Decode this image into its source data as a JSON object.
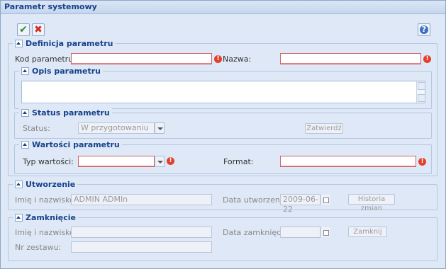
{
  "window": {
    "title": "Parametr systemowy"
  },
  "toolbar": {
    "ok_icon": "check-icon",
    "cancel_icon": "x-icon",
    "help_icon": "question-icon"
  },
  "definicja": {
    "legend": "Definicja parametru",
    "kod_label": "Kod parametru:",
    "kod_value": "",
    "nazwa_label": "Nazwa:",
    "nazwa_value": "",
    "opis": {
      "legend": "Opis parametru",
      "value": ""
    },
    "status": {
      "legend": "Status parametru",
      "label": "Status:",
      "value": "W przygotowaniu",
      "button": "Zatwierdź"
    },
    "wartosci": {
      "legend": "Wartości parametru",
      "typ_label": "Typ wartości:",
      "typ_value": "",
      "format_label": "Format:",
      "format_value": ""
    }
  },
  "utworzenie": {
    "legend": "Utworzenie",
    "imie_label": "Imię i nazwisko:",
    "imie_value": "ADMIN ADMIn",
    "data_label": "Data utworzenia:",
    "data_value": "2009-06-22",
    "historia_button": "Historia zmian"
  },
  "zamkniecie": {
    "legend": "Zamknięcie",
    "imie_label": "Imię i nazwisko:",
    "imie_value": "",
    "data_label": "Data zamknięcia:",
    "data_value": "",
    "zamknij_button": "Zamknij",
    "nr_label": "Nr zestawu:",
    "nr_value": ""
  },
  "colors": {
    "title": "#15428b",
    "background": "#dfe8f6",
    "error": "#e3402b"
  }
}
